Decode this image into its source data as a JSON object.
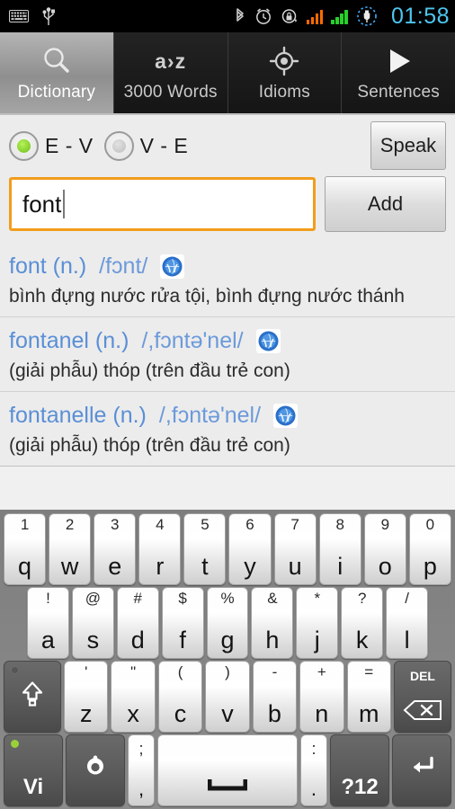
{
  "statusbar": {
    "time": "01:58",
    "left_icons": [
      "keyboard-icon",
      "usb-icon"
    ],
    "right_icons": [
      "bluetooth-icon",
      "alarm-icon",
      "rotation-lock-icon",
      "signal-bars-orange-icon",
      "signal-bars-green-icon",
      "battery-charging-icon"
    ],
    "clock_color": "#4cc7f0"
  },
  "tabs": [
    {
      "label": "Dictionary",
      "icon": "magnifier-icon",
      "active": true
    },
    {
      "label": "3000 Words",
      "icon": "a-to-z-icon",
      "icon_text": "a›z",
      "active": false
    },
    {
      "label": "Idioms",
      "icon": "target-icon",
      "active": false
    },
    {
      "label": "Sentences",
      "icon": "play-icon",
      "active": false
    }
  ],
  "options": {
    "direction_ev": "E - V",
    "direction_ve": "V - E",
    "selected": "E - V",
    "speak_label": "Speak",
    "accent_selected": "#6cbf15"
  },
  "search": {
    "value": "font",
    "placeholder": "",
    "add_label": "Add",
    "focus_color": "#f29d1d"
  },
  "results": [
    {
      "word": "font (n.)",
      "ipa": "/fɔnt/",
      "definition": "bình đựng nước rửa tội, bình đựng nước thánh",
      "audio_icon": "audio-globe-icon"
    },
    {
      "word": "fontanel (n.)",
      "ipa": "/,fɔntə'nel/",
      "definition": "(giải phẫu) thóp (trên đầu trẻ con)",
      "audio_icon": "audio-globe-icon"
    },
    {
      "word": "fontanelle (n.)",
      "ipa": "/,fɔntə'nel/",
      "definition": "(giải phẫu) thóp (trên đầu trẻ con)",
      "audio_icon": "audio-globe-icon"
    }
  ],
  "keyboard": {
    "row1": [
      {
        "main": "q",
        "sup": "1"
      },
      {
        "main": "w",
        "sup": "2"
      },
      {
        "main": "e",
        "sup": "3"
      },
      {
        "main": "r",
        "sup": "4"
      },
      {
        "main": "t",
        "sup": "5"
      },
      {
        "main": "y",
        "sup": "6"
      },
      {
        "main": "u",
        "sup": "7"
      },
      {
        "main": "i",
        "sup": "8"
      },
      {
        "main": "o",
        "sup": "9"
      },
      {
        "main": "p",
        "sup": "0"
      }
    ],
    "row2": [
      {
        "main": "a",
        "sup": "!"
      },
      {
        "main": "s",
        "sup": "@"
      },
      {
        "main": "d",
        "sup": "#"
      },
      {
        "main": "f",
        "sup": "$"
      },
      {
        "main": "g",
        "sup": "%"
      },
      {
        "main": "h",
        "sup": "&"
      },
      {
        "main": "j",
        "sup": "*"
      },
      {
        "main": "k",
        "sup": "?"
      },
      {
        "main": "l",
        "sup": "/"
      }
    ],
    "row3": [
      {
        "main": "z",
        "sup": "'"
      },
      {
        "main": "x",
        "sup": "\""
      },
      {
        "main": "c",
        "sup": "("
      },
      {
        "main": "v",
        "sup": ")"
      },
      {
        "main": "b",
        "sup": "-"
      },
      {
        "main": "n",
        "sup": "+"
      },
      {
        "main": "m",
        "sup": "="
      }
    ],
    "shift_key": "shift-key",
    "delete_key": "DEL",
    "lang_key": "Vi",
    "settings_key": "keyboard-settings-icon",
    "semicolon_top": ";",
    "semicolon_bottom": ",",
    "colon_top": ":",
    "colon_bottom": ".",
    "space_key": "space-key",
    "symbols_key": "?12",
    "enter_key": "enter-key"
  }
}
